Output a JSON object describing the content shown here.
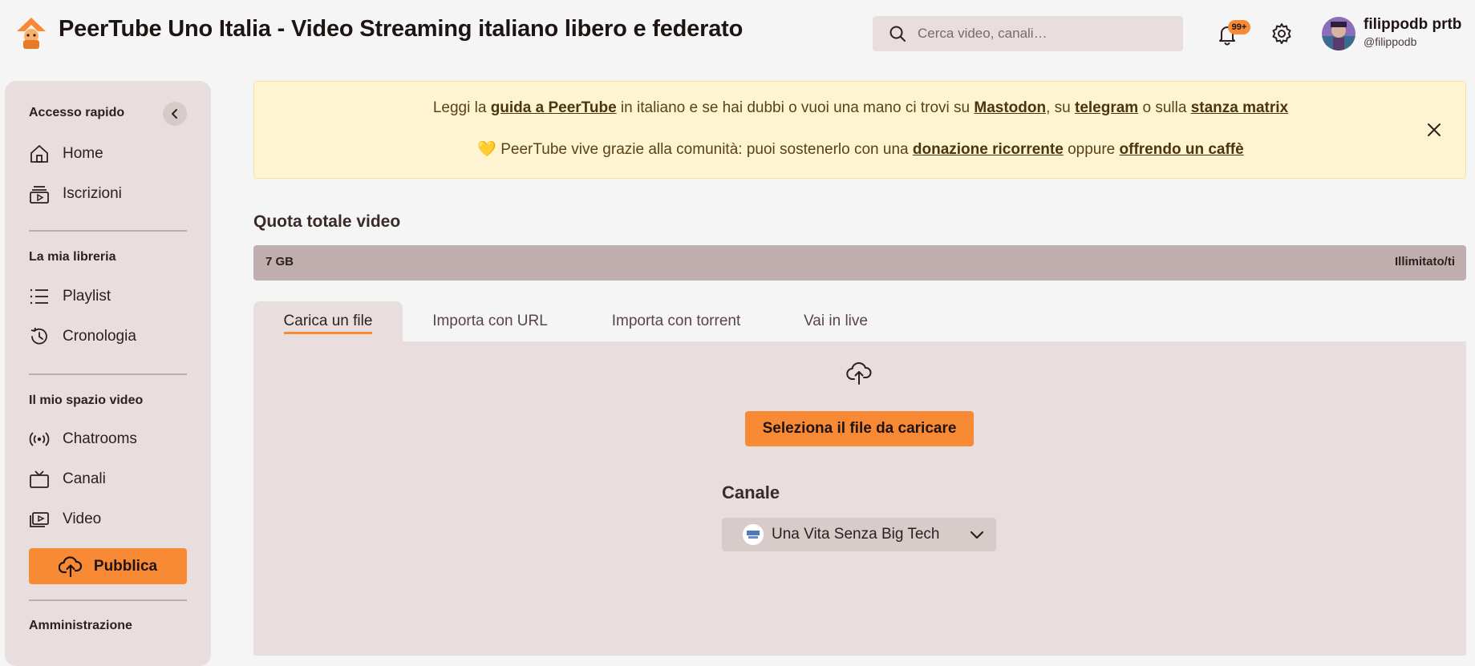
{
  "header": {
    "site_title": "PeerTube Uno Italia - Video Streaming italiano libero e federato",
    "search_placeholder": "Cerca video, canali…",
    "notifications_badge": "99+",
    "user": {
      "display_name": "filippodb prtb",
      "handle": "@filippodb"
    },
    "icons": [
      "peertube-logo",
      "search-icon",
      "bell-icon",
      "gear-icon",
      "avatar"
    ]
  },
  "sidebar": {
    "quick_access": {
      "title": "Accesso rapido",
      "items": [
        {
          "label": "Home",
          "icon": "home-icon"
        },
        {
          "label": "Iscrizioni",
          "icon": "subscriptions-icon"
        }
      ]
    },
    "library": {
      "title": "La mia libreria",
      "items": [
        {
          "label": "Playlist",
          "icon": "list-icon"
        },
        {
          "label": "Cronologia",
          "icon": "history-icon"
        }
      ]
    },
    "video_space": {
      "title": "Il mio spazio video",
      "items": [
        {
          "label": "Chatrooms",
          "icon": "broadcast-icon"
        },
        {
          "label": "Canali",
          "icon": "tv-icon"
        },
        {
          "label": "Video",
          "icon": "video-icon"
        }
      ]
    },
    "publish_label": "Pubblica",
    "admin_title": "Amministrazione"
  },
  "banner": {
    "line1": {
      "t1": "Leggi la ",
      "link1": "guida a PeerTube",
      "t2": " in italiano e se hai dubbi o vuoi una mano ci trovi su ",
      "link2": "Mastodon",
      "t3": ", su ",
      "link3": "telegram",
      "t4": " o sulla ",
      "link4": "stanza matrix"
    },
    "line2": {
      "t1": "💛 PeerTube vive grazie alla comunità: puoi sostenerlo con una ",
      "link1": "donazione ricorrente",
      "t2": " oppure ",
      "link2": "offrendo un caffè"
    }
  },
  "quota": {
    "title": "Quota totale video",
    "used": "7 GB",
    "limit": "Illimitato/ti"
  },
  "tabs": [
    {
      "label": "Carica un file",
      "active": true
    },
    {
      "label": "Importa con URL",
      "active": false
    },
    {
      "label": "Importa con torrent",
      "active": false
    },
    {
      "label": "Vai in live",
      "active": false
    }
  ],
  "upload": {
    "select_button": "Seleziona il file da caricare",
    "channel_label": "Canale",
    "channel_value": "Una Vita Senza Big Tech"
  },
  "colors": {
    "accent": "#f98a35",
    "sidebar_bg": "#e8dedd",
    "banner_bg": "#fff4d1",
    "quota_bar": "#c0aeae"
  }
}
